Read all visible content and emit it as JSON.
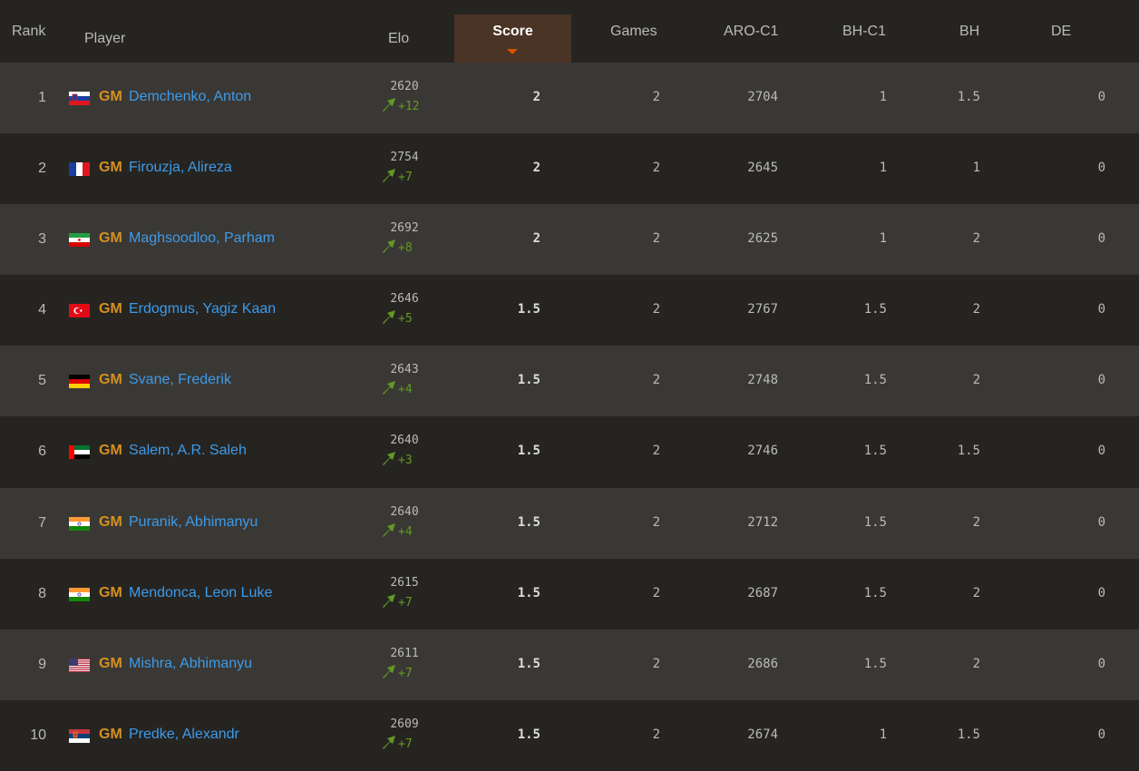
{
  "header": {
    "rank": "Rank",
    "player": "Player",
    "elo": "Elo",
    "score": "Score",
    "games": "Games",
    "aro": "ARO-C1",
    "bhc1": "BH-C1",
    "bh": "BH",
    "de": "DE"
  },
  "colors": {
    "title": "#d59020",
    "name": "#3d9be9",
    "elo_up": "#629924",
    "sorted_header_bg": "#4a3425",
    "sort_arrow": "#d85000"
  },
  "rows": [
    {
      "rank": "1",
      "flag": "slovenia-flag",
      "title": "GM",
      "name": "Demchenko, Anton",
      "elo": "2620",
      "elo_change": "+12",
      "score": "2",
      "games": "2",
      "aro": "2704",
      "bhc1": "1",
      "bh": "1.5",
      "de": "0"
    },
    {
      "rank": "2",
      "flag": "france-flag",
      "title": "GM",
      "name": "Firouzja, Alireza",
      "elo": "2754",
      "elo_change": "+7",
      "score": "2",
      "games": "2",
      "aro": "2645",
      "bhc1": "1",
      "bh": "1",
      "de": "0"
    },
    {
      "rank": "3",
      "flag": "iran-flag",
      "title": "GM",
      "name": "Maghsoodloo, Parham",
      "elo": "2692",
      "elo_change": "+8",
      "score": "2",
      "games": "2",
      "aro": "2625",
      "bhc1": "1",
      "bh": "2",
      "de": "0"
    },
    {
      "rank": "4",
      "flag": "turkey-flag",
      "title": "GM",
      "name": "Erdogmus, Yagiz Kaan",
      "elo": "2646",
      "elo_change": "+5",
      "score": "1.5",
      "games": "2",
      "aro": "2767",
      "bhc1": "1.5",
      "bh": "2",
      "de": "0"
    },
    {
      "rank": "5",
      "flag": "germany-flag",
      "title": "GM",
      "name": "Svane, Frederik",
      "elo": "2643",
      "elo_change": "+4",
      "score": "1.5",
      "games": "2",
      "aro": "2748",
      "bhc1": "1.5",
      "bh": "2",
      "de": "0"
    },
    {
      "rank": "6",
      "flag": "uae-flag",
      "title": "GM",
      "name": "Salem, A.R. Saleh",
      "elo": "2640",
      "elo_change": "+3",
      "score": "1.5",
      "games": "2",
      "aro": "2746",
      "bhc1": "1.5",
      "bh": "1.5",
      "de": "0"
    },
    {
      "rank": "7",
      "flag": "india-flag",
      "title": "GM",
      "name": "Puranik, Abhimanyu",
      "elo": "2640",
      "elo_change": "+4",
      "score": "1.5",
      "games": "2",
      "aro": "2712",
      "bhc1": "1.5",
      "bh": "2",
      "de": "0"
    },
    {
      "rank": "8",
      "flag": "india-flag",
      "title": "GM",
      "name": "Mendonca, Leon Luke",
      "elo": "2615",
      "elo_change": "+7",
      "score": "1.5",
      "games": "2",
      "aro": "2687",
      "bhc1": "1.5",
      "bh": "2",
      "de": "0"
    },
    {
      "rank": "9",
      "flag": "usa-flag",
      "title": "GM",
      "name": "Mishra, Abhimanyu",
      "elo": "2611",
      "elo_change": "+7",
      "score": "1.5",
      "games": "2",
      "aro": "2686",
      "bhc1": "1.5",
      "bh": "2",
      "de": "0"
    },
    {
      "rank": "10",
      "flag": "serbia-flag",
      "title": "GM",
      "name": "Predke, Alexandr",
      "elo": "2609",
      "elo_change": "+7",
      "score": "1.5",
      "games": "2",
      "aro": "2674",
      "bhc1": "1",
      "bh": "1.5",
      "de": "0"
    }
  ]
}
